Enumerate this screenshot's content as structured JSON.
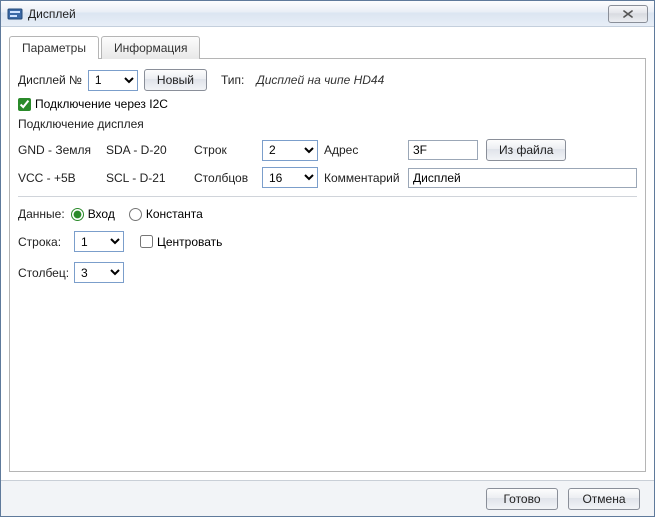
{
  "window": {
    "title": "Дисплей"
  },
  "tabs": {
    "params": "Параметры",
    "info": "Информация"
  },
  "top": {
    "display_no_label": "Дисплей №",
    "display_no_value": "1",
    "new_btn": "Новый",
    "type_label": "Тип:",
    "type_value": "Дисплей на чипе HD44",
    "i2c_label": "Подключение через I2C"
  },
  "section_title": "Подключение дисплея",
  "conn": {
    "gnd_lbl": "GND - Земля",
    "sda_lbl": "SDA - D-20",
    "rows_lbl": "Строк",
    "rows_val": "2",
    "addr_lbl": "Адрес",
    "addr_val": "3F",
    "file_btn": "Из файла",
    "vcc_lbl": "VCC - +5B",
    "scl_lbl": "SCL - D-21",
    "cols_lbl": "Столбцов",
    "cols_val": "16",
    "comment_lbl": "Комментарий",
    "comment_val": "Дисплей"
  },
  "data_sec": {
    "data_lbl": "Данные:",
    "opt_input": "Вход",
    "opt_const": "Константа",
    "row_lbl": "Строка:",
    "row_val": "1",
    "center_lbl": "Центровать",
    "col_lbl": "Столбец:",
    "col_val": "3"
  },
  "footer": {
    "ok": "Готово",
    "cancel": "Отмена"
  }
}
